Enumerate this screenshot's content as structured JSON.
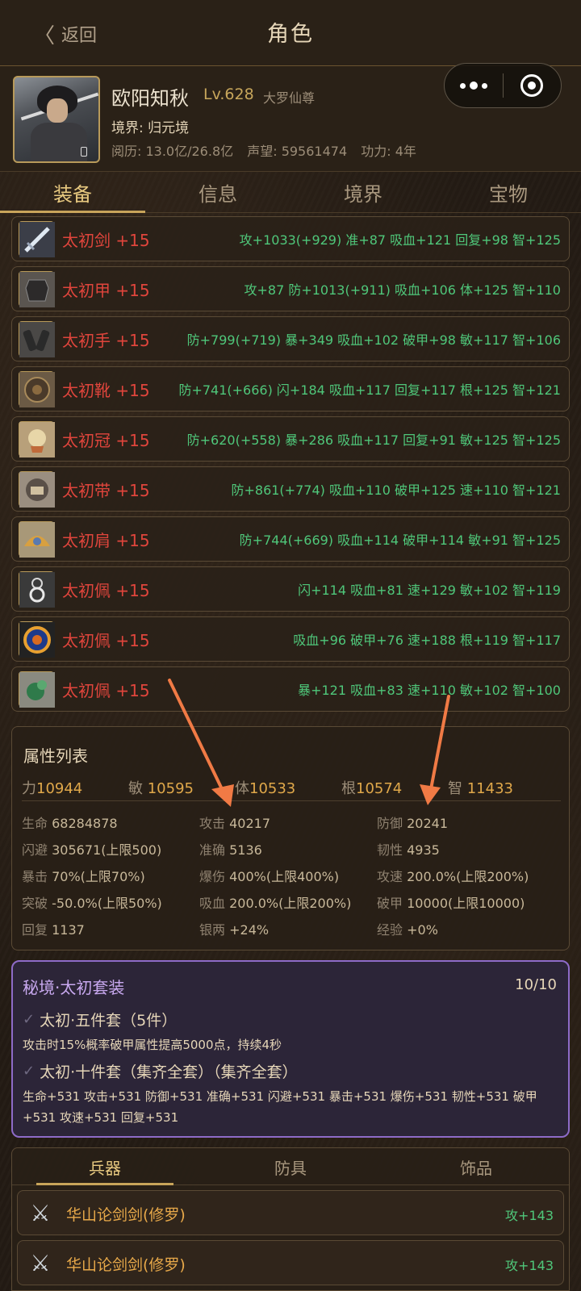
{
  "nav": {
    "back_label": "返回",
    "title": "角色"
  },
  "profile": {
    "name": "欧阳知秋",
    "level": "Lv.628",
    "title": "大罗仙尊",
    "realm": "境界: 归元境",
    "experience": "阅历: 13.0亿/26.8亿",
    "prestige": "声望: 59561474",
    "power": "功力: 4年"
  },
  "tabs": [
    "装备",
    "信息",
    "境界",
    "宝物"
  ],
  "equipment": [
    {
      "name": "太初剑 +15",
      "stats": "攻+1033(+929) 准+87 吸血+121 回复+98 智+125",
      "icon": "sword-icon"
    },
    {
      "name": "太初甲 +15",
      "stats": "攻+87 防+1013(+911) 吸血+106 体+125 智+110",
      "icon": "armor-icon"
    },
    {
      "name": "太初手 +15",
      "stats": "防+799(+719) 暴+349 吸血+102 破甲+98 敏+117 智+106",
      "icon": "gauntlet-icon"
    },
    {
      "name": "太初靴 +15",
      "stats": "防+741(+666) 闪+184 吸血+117 回复+117 根+125 智+121",
      "icon": "boots-icon"
    },
    {
      "name": "太初冠 +15",
      "stats": "防+620(+558) 暴+286 吸血+117 回复+91 敏+125 智+125",
      "icon": "crown-icon"
    },
    {
      "name": "太初带 +15",
      "stats": "防+861(+774) 吸血+110 破甲+125 速+110 智+121",
      "icon": "belt-icon"
    },
    {
      "name": "太初肩 +15",
      "stats": "防+744(+669) 吸血+114 破甲+114 敏+91 智+125",
      "icon": "shoulder-icon"
    },
    {
      "name": "太初佩 +15",
      "stats": "闪+114 吸血+81 速+129 敏+102 智+119",
      "icon": "pendant-icon"
    },
    {
      "name": "太初佩 +15",
      "stats": "吸血+96 破甲+76 速+188 根+119 智+117",
      "icon": "orb-icon"
    },
    {
      "name": "太初佩 +15",
      "stats": "暴+121 吸血+83 速+110 敏+102 智+100",
      "icon": "jade-icon"
    }
  ],
  "attributes": {
    "title": "属性列表",
    "primary": [
      {
        "label": "力",
        "value": "10944"
      },
      {
        "label": "敏",
        "value": "10595"
      },
      {
        "label": "体",
        "value": "10533"
      },
      {
        "label": "根",
        "value": "10574"
      },
      {
        "label": "智",
        "value": "11433"
      }
    ],
    "grid": [
      {
        "label": "生命",
        "value": "68284878"
      },
      {
        "label": "攻击",
        "value": "40217"
      },
      {
        "label": "防御",
        "value": "20241"
      },
      {
        "label": "闪避",
        "value": "305671(上限500)"
      },
      {
        "label": "准确",
        "value": "5136"
      },
      {
        "label": "韧性",
        "value": "4935"
      },
      {
        "label": "暴击",
        "value": "70%(上限70%)"
      },
      {
        "label": "爆伤",
        "value": "400%(上限400%)"
      },
      {
        "label": "攻速",
        "value": "200.0%(上限200%)"
      },
      {
        "label": "突破",
        "value": "-50.0%(上限50%)"
      },
      {
        "label": "吸血",
        "value": "200.0%(上限200%)"
      },
      {
        "label": "破甲",
        "value": "10000(上限10000)"
      },
      {
        "label": "回复",
        "value": "1137"
      },
      {
        "label": "银两",
        "value": "+24%"
      },
      {
        "label": "经验",
        "value": "+0%"
      }
    ]
  },
  "set_bonus": {
    "title": "秘境·太初套装",
    "count": "10/10",
    "five_title": "太初·五件套（5件）",
    "five_desc": "攻击时15%概率破甲属性提高5000点，持续4秒",
    "ten_title": "太初·十件套（集齐全套）（集齐全套）",
    "ten_desc": "生命+531 攻击+531 防御+531 准确+531 闪避+531 暴击+531 爆伤+531 韧性+531 破甲+531 攻速+531 回复+531"
  },
  "subtabs": [
    "兵器",
    "防具",
    "饰品"
  ],
  "weapons": [
    {
      "name": "华山论剑剑(修罗)",
      "stat": "攻+143"
    },
    {
      "name": "华山论剑剑(修罗)",
      "stat": "攻+143"
    }
  ],
  "colors": {
    "accent": "#c8a45a",
    "equip_name": "#e0453c",
    "stat_green": "#4fc77a",
    "set_border": "#8e6bc8",
    "annotation_arrow": "#f07a45"
  }
}
